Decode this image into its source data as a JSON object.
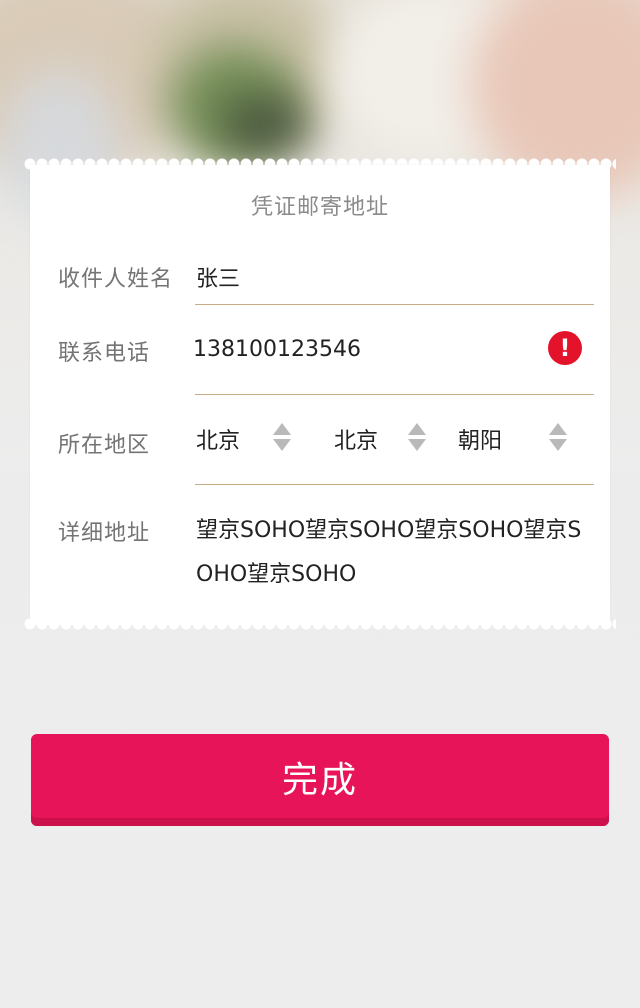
{
  "card": {
    "title": "凭证邮寄地址",
    "recipient": {
      "label": "收件人姓名",
      "value": "张三"
    },
    "phone": {
      "label": "联系电话",
      "value": "138100123546",
      "error_icon": "exclamation-icon",
      "error_symbol": "!"
    },
    "region": {
      "label": "所在地区",
      "province": "北京",
      "city": "北京",
      "district": "朝阳",
      "selector_icon": "up-down-arrows-icon"
    },
    "address": {
      "label": "详细地址",
      "value": "望京SOHO望京SOHO望京SOHO望京SOHO望京SOHO"
    }
  },
  "button": {
    "done_label": "完成"
  },
  "colors": {
    "accent": "#e8145a",
    "error": "#e3132b",
    "underline": "#c9ad88",
    "label": "#747474"
  }
}
